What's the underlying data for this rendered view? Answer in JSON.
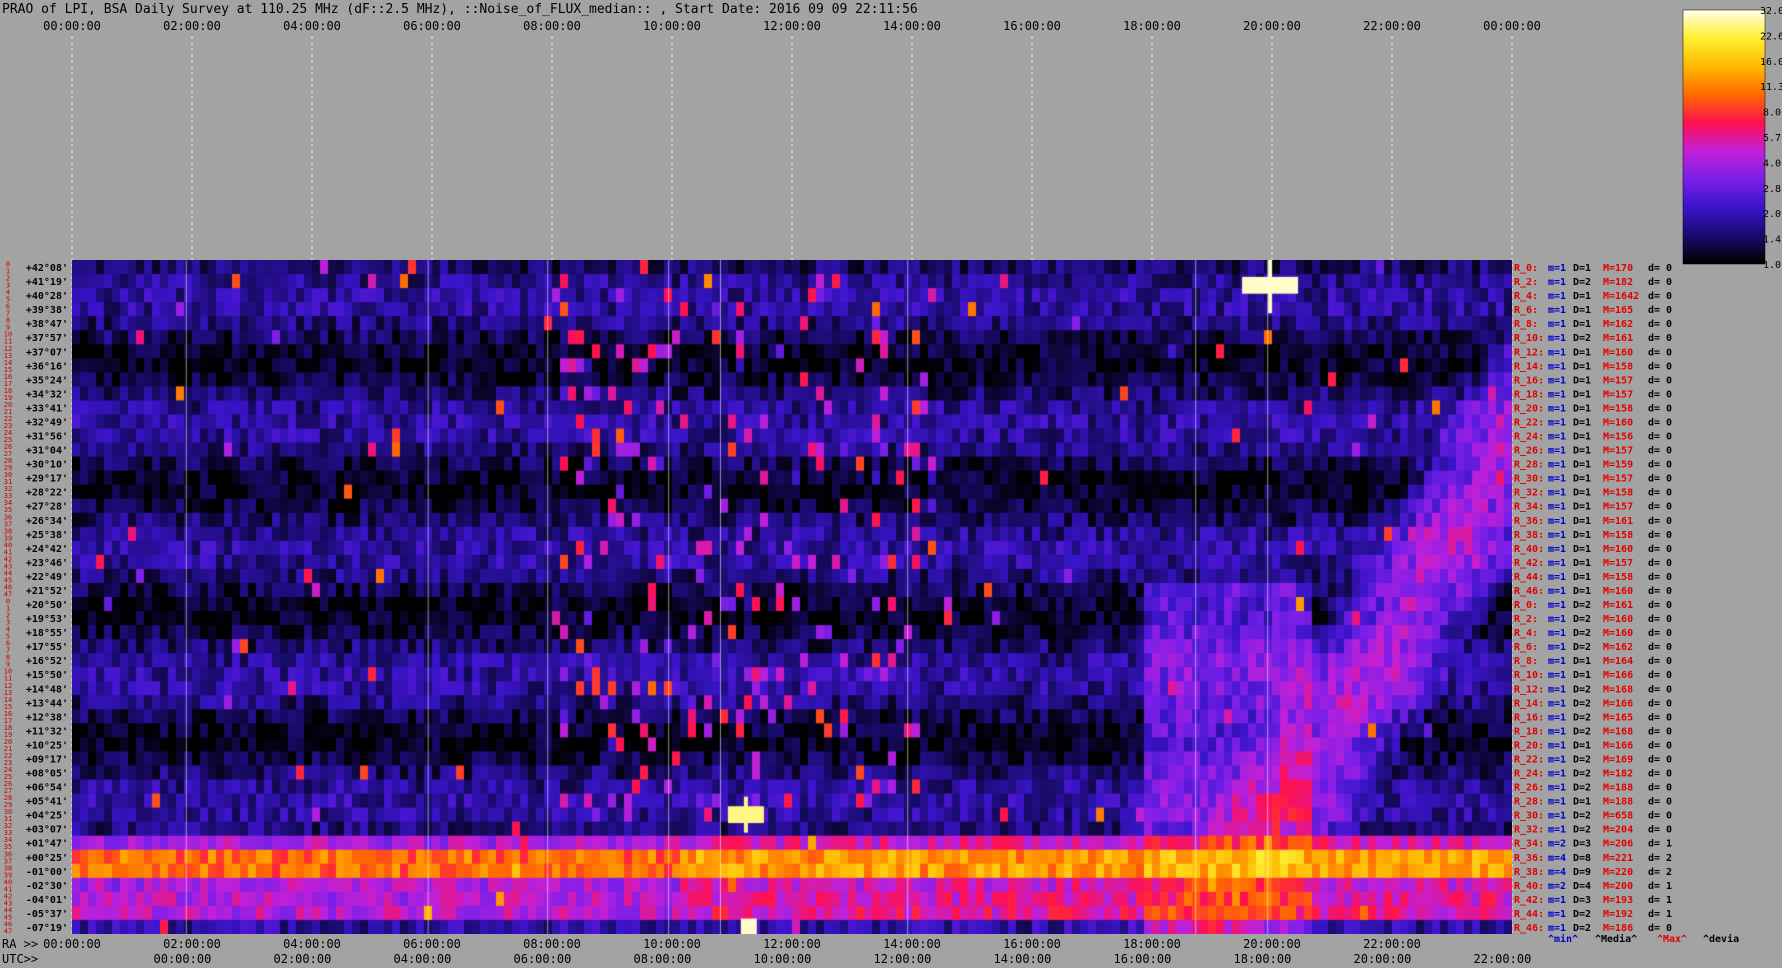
{
  "title": "PRAO of LPI, BSA Daily Survey at 110.25 MHz (dF::2.5 MHz), ::Noise_of_FLUX_median:: , Start Date: 2016 09 09 22:11:56",
  "chart_data": {
    "type": "heatmap",
    "top_axis_ticks": [
      "00:00:00",
      "02:00:00",
      "04:00:00",
      "06:00:00",
      "08:00:00",
      "10:00:00",
      "12:00:00",
      "14:00:00",
      "16:00:00",
      "18:00:00",
      "20:00:00",
      "22:00:00",
      "00:00:00"
    ],
    "bottom_ra_prefix": "RA >>",
    "bottom_ra_ticks": [
      "00:00:00",
      "02:00:00",
      "04:00:00",
      "06:00:00",
      "08:00:00",
      "10:00:00",
      "12:00:00",
      "14:00:00",
      "16:00:00",
      "18:00:00",
      "20:00:00",
      "22:00:00"
    ],
    "bottom_utc_prefix": "UTC>>",
    "bottom_utc_ticks": [
      "00:00:00",
      "02:00:00",
      "04:00:00",
      "06:00:00",
      "08:00:00",
      "10:00:00",
      "12:00:00",
      "14:00:00",
      "16:00:00",
      "18:00:00",
      "20:00:00",
      "22:00:00"
    ],
    "dec_labels": [
      "+42°08'",
      "+41°19'",
      "+40°28'",
      "+39°38'",
      "+38°47'",
      "+37°57'",
      "+37°07'",
      "+36°16'",
      "+35°24'",
      "+34°32'",
      "+33°41'",
      "+32°49'",
      "+31°56'",
      "+31°04'",
      "+30°10'",
      "+29°17'",
      "+28°22'",
      "+27°28'",
      "+26°34'",
      "+25°38'",
      "+24°42'",
      "+23°46'",
      "+22°49'",
      "+21°52'",
      "+20°50'",
      "+19°53'",
      "+18°55'",
      "+17°55'",
      "+16°52'",
      "+15°50'",
      "+14°48'",
      "+13°44'",
      "+12°38'",
      "+11°32'",
      "+10°25'",
      "+09°17'",
      "+08°05'",
      "+06°54'",
      "+05°41'",
      "+04°25'",
      "+03°07'",
      "+01°47'",
      "+00°25'",
      "-01°00'",
      "-02°30'",
      "-04°01'",
      "-05°37'",
      "-07°19'"
    ],
    "beam_numbers": [
      "0",
      "1",
      "2",
      "3",
      "4",
      "5",
      "6",
      "7",
      "8",
      "9",
      "10",
      "11",
      "12",
      "13",
      "14",
      "15",
      "16",
      "17",
      "18",
      "19",
      "20",
      "21",
      "22",
      "23",
      "24",
      "25",
      "26",
      "27",
      "28",
      "29",
      "30",
      "31",
      "32",
      "33",
      "34",
      "35",
      "36",
      "37",
      "38",
      "39",
      "40",
      "41",
      "42",
      "43",
      "44",
      "45",
      "46",
      "47",
      "0",
      "1",
      "2",
      "3",
      "4",
      "5",
      "6",
      "7",
      "8",
      "9",
      "10",
      "11",
      "12",
      "13",
      "14",
      "15",
      "16",
      "17",
      "18",
      "19",
      "20",
      "21",
      "22",
      "23",
      "24",
      "25",
      "26",
      "27",
      "28",
      "29",
      "30",
      "31",
      "32",
      "33",
      "34",
      "35",
      "36",
      "37",
      "38",
      "39",
      "40",
      "41",
      "42",
      "43",
      "44",
      "45",
      "46",
      "47"
    ],
    "row_stats": [
      {
        "r": "R_0:",
        "m": "m=1",
        "D": "D=1",
        "M": "M=170",
        "d": "d= 0"
      },
      {
        "r": "R_2:",
        "m": "m=1",
        "D": "D=2",
        "M": "M=182",
        "d": "d= 0"
      },
      {
        "r": "R_4:",
        "m": "m=1",
        "D": "D=1",
        "M": "M=1642",
        "d": "d= 0"
      },
      {
        "r": "R_6:",
        "m": "m=1",
        "D": "D=1",
        "M": "M=165",
        "d": "d= 0"
      },
      {
        "r": "R_8:",
        "m": "m=1",
        "D": "D=1",
        "M": "M=162",
        "d": "d= 0"
      },
      {
        "r": "R_10:",
        "m": "m=1",
        "D": "D=2",
        "M": "M=161",
        "d": "d= 0"
      },
      {
        "r": "R_12:",
        "m": "m=1",
        "D": "D=1",
        "M": "M=160",
        "d": "d= 0"
      },
      {
        "r": "R_14:",
        "m": "m=1",
        "D": "D=1",
        "M": "M=158",
        "d": "d= 0"
      },
      {
        "r": "R_16:",
        "m": "m=1",
        "D": "D=1",
        "M": "M=157",
        "d": "d= 0"
      },
      {
        "r": "R_18:",
        "m": "m=1",
        "D": "D=1",
        "M": "M=157",
        "d": "d= 0"
      },
      {
        "r": "R_20:",
        "m": "m=1",
        "D": "D=1",
        "M": "M=158",
        "d": "d= 0"
      },
      {
        "r": "R_22:",
        "m": "m=1",
        "D": "D=1",
        "M": "M=160",
        "d": "d= 0"
      },
      {
        "r": "R_24:",
        "m": "m=1",
        "D": "D=1",
        "M": "M=156",
        "d": "d= 0"
      },
      {
        "r": "R_26:",
        "m": "m=1",
        "D": "D=1",
        "M": "M=157",
        "d": "d= 0"
      },
      {
        "r": "R_28:",
        "m": "m=1",
        "D": "D=1",
        "M": "M=159",
        "d": "d= 0"
      },
      {
        "r": "R_30:",
        "m": "m=1",
        "D": "D=1",
        "M": "M=157",
        "d": "d= 0"
      },
      {
        "r": "R_32:",
        "m": "m=1",
        "D": "D=1",
        "M": "M=158",
        "d": "d= 0"
      },
      {
        "r": "R_34:",
        "m": "m=1",
        "D": "D=1",
        "M": "M=157",
        "d": "d= 0"
      },
      {
        "r": "R_36:",
        "m": "m=1",
        "D": "D=1",
        "M": "M=161",
        "d": "d= 0"
      },
      {
        "r": "R_38:",
        "m": "m=1",
        "D": "D=1",
        "M": "M=158",
        "d": "d= 0"
      },
      {
        "r": "R_40:",
        "m": "m=1",
        "D": "D=1",
        "M": "M=160",
        "d": "d= 0"
      },
      {
        "r": "R_42:",
        "m": "m=1",
        "D": "D=1",
        "M": "M=157",
        "d": "d= 0"
      },
      {
        "r": "R_44:",
        "m": "m=1",
        "D": "D=1",
        "M": "M=158",
        "d": "d= 0"
      },
      {
        "r": "R_46:",
        "m": "m=1",
        "D": "D=1",
        "M": "M=160",
        "d": "d= 0"
      },
      {
        "r": "R_0:",
        "m": "m=1",
        "D": "D=2",
        "M": "M=161",
        "d": "d= 0"
      },
      {
        "r": "R_2:",
        "m": "m=1",
        "D": "D=2",
        "M": "M=160",
        "d": "d= 0"
      },
      {
        "r": "R_4:",
        "m": "m=1",
        "D": "D=2",
        "M": "M=160",
        "d": "d= 0"
      },
      {
        "r": "R_6:",
        "m": "m=1",
        "D": "D=2",
        "M": "M=162",
        "d": "d= 0"
      },
      {
        "r": "R_8:",
        "m": "m=1",
        "D": "D=1",
        "M": "M=164",
        "d": "d= 0"
      },
      {
        "r": "R_10:",
        "m": "m=1",
        "D": "D=1",
        "M": "M=166",
        "d": "d= 0"
      },
      {
        "r": "R_12:",
        "m": "m=1",
        "D": "D=2",
        "M": "M=168",
        "d": "d= 0"
      },
      {
        "r": "R_14:",
        "m": "m=1",
        "D": "D=2",
        "M": "M=166",
        "d": "d= 0"
      },
      {
        "r": "R_16:",
        "m": "m=1",
        "D": "D=2",
        "M": "M=165",
        "d": "d= 0"
      },
      {
        "r": "R_18:",
        "m": "m=1",
        "D": "D=2",
        "M": "M=168",
        "d": "d= 0"
      },
      {
        "r": "R_20:",
        "m": "m=1",
        "D": "D=1",
        "M": "M=166",
        "d": "d= 0"
      },
      {
        "r": "R_22:",
        "m": "m=1",
        "D": "D=2",
        "M": "M=169",
        "d": "d= 0"
      },
      {
        "r": "R_24:",
        "m": "m=1",
        "D": "D=2",
        "M": "M=182",
        "d": "d= 0"
      },
      {
        "r": "R_26:",
        "m": "m=1",
        "D": "D=2",
        "M": "M=188",
        "d": "d= 0"
      },
      {
        "r": "R_28:",
        "m": "m=1",
        "D": "D=1",
        "M": "M=188",
        "d": "d= 0"
      },
      {
        "r": "R_30:",
        "m": "m=1",
        "D": "D=2",
        "M": "M=658",
        "d": "d= 0"
      },
      {
        "r": "R_32:",
        "m": "m=1",
        "D": "D=2",
        "M": "M=204",
        "d": "d= 0"
      },
      {
        "r": "R_34:",
        "m": "m=2",
        "D": "D=3",
        "M": "M=206",
        "d": "d= 1"
      },
      {
        "r": "R_36:",
        "m": "m=4",
        "D": "D=8",
        "M": "M=221",
        "d": "d= 2"
      },
      {
        "r": "R_38:",
        "m": "m=4",
        "D": "D=9",
        "M": "M=220",
        "d": "d= 2"
      },
      {
        "r": "R_40:",
        "m": "m=2",
        "D": "D=4",
        "M": "M=200",
        "d": "d= 1"
      },
      {
        "r": "R_42:",
        "m": "m=1",
        "D": "D=3",
        "M": "M=193",
        "d": "d= 1"
      },
      {
        "r": "R_44:",
        "m": "m=1",
        "D": "D=2",
        "M": "M=192",
        "d": "d= 1"
      },
      {
        "r": "R_46:",
        "m": "m=1",
        "D": "D=2",
        "M": "M=186",
        "d": "d= 0"
      }
    ],
    "stats_legend": {
      "min": "^min^",
      "media": "^Media^",
      "max": "^Max^",
      "devia": "^devia"
    },
    "colorbar_ticks": [
      "32.0",
      "22.6",
      "16.0",
      "11.3",
      "8.0",
      "5.7",
      "4.0",
      "2.8",
      "2.0",
      "1.4",
      "1.0"
    ],
    "colorbar_range": [
      1.0,
      32.0
    ],
    "colorbar_scale": "log",
    "colormap": [
      "#000000",
      "#1a0b6e",
      "#3a14c8",
      "#7a1fe8",
      "#c020d8",
      "#ff1050",
      "#ff6a00",
      "#ffb800",
      "#ffef30",
      "#ffffe8"
    ],
    "colors": {
      "background": "#a3a3a3",
      "stat_label": "#e00000",
      "stat_min": "#0000cc",
      "stat_max": "#e00000",
      "beam_num": "#cc0000"
    }
  }
}
